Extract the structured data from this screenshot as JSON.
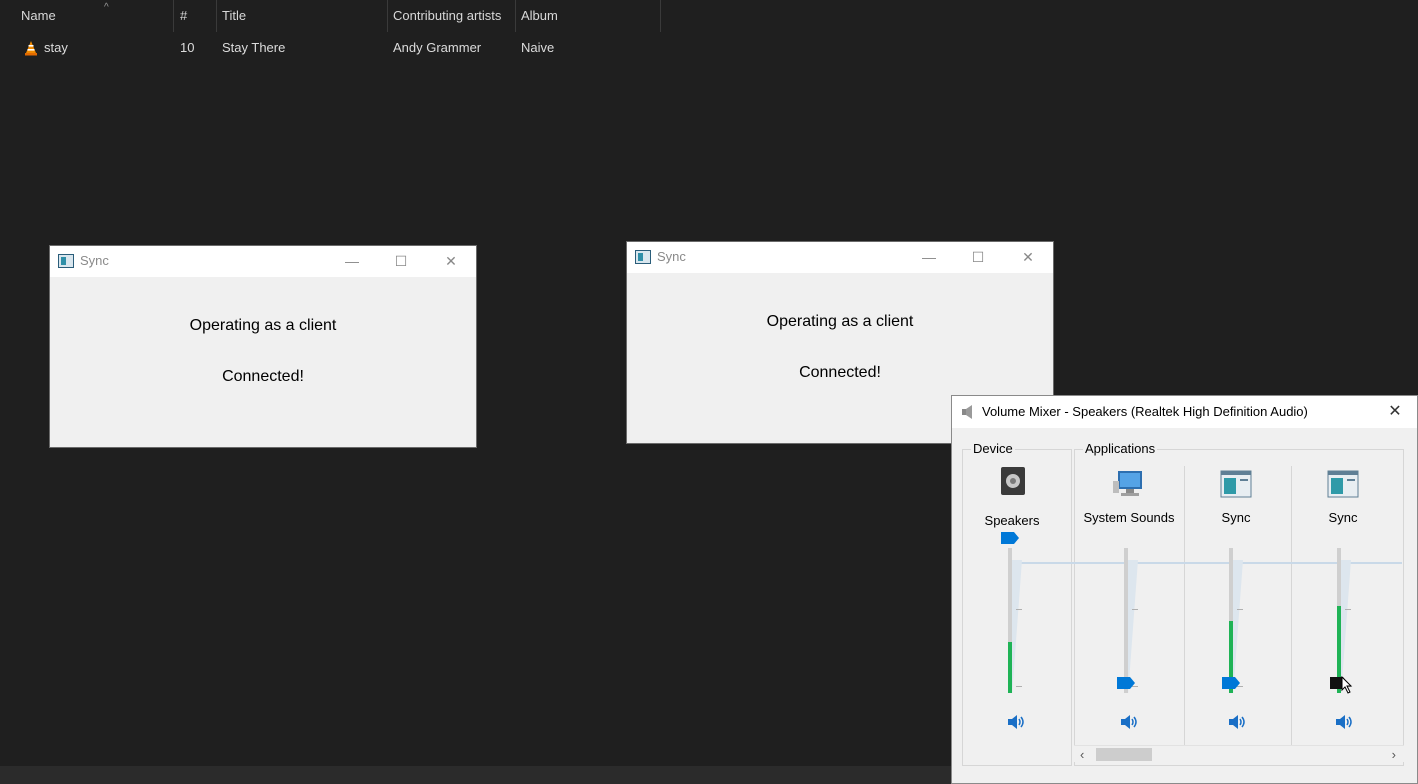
{
  "explorer": {
    "columns": [
      "Name",
      "#",
      "Title",
      "Contributing artists",
      "Album"
    ],
    "sort_indicator": "^",
    "rows": [
      {
        "name": "stay",
        "number": "10",
        "title": "Stay There",
        "artist": "Andy Grammer",
        "album": "Naive",
        "icon": "vlc-cone-icon"
      }
    ]
  },
  "sync_windows": [
    {
      "title": "Sync",
      "line1": "Operating as a client",
      "line2": "Connected!"
    },
    {
      "title": "Sync",
      "line1": "Operating as a client",
      "line2": "Connected!"
    }
  ],
  "titlebar_glyphs": {
    "minimize": "—",
    "maximize": "☐",
    "close": "✕"
  },
  "mixer": {
    "title": "Volume Mixer - Speakers (Realtek High Definition Audio)",
    "device_group_label": "Device",
    "applications_group_label": "Applications",
    "channels": [
      {
        "label": "Speakers",
        "icon": "speaker-device-icon",
        "volume": 1.0,
        "peak": 0.35
      },
      {
        "label": "System Sounds",
        "icon": "system-sounds-icon",
        "volume": 0.0,
        "peak": 0.0
      },
      {
        "label": "Sync",
        "icon": "sync-app-icon",
        "volume": 0.0,
        "peak": 0.5
      },
      {
        "label": "Sync",
        "icon": "sync-app-icon",
        "volume": 0.0,
        "peak": 0.6
      }
    ],
    "accent_color": "#0078d7",
    "level_color": "#1fb356"
  }
}
